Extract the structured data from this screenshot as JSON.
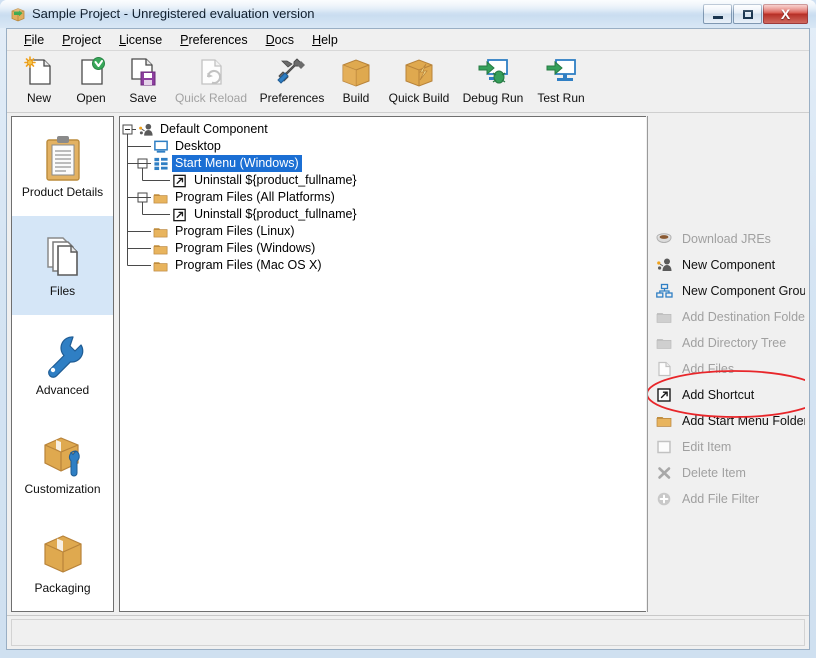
{
  "window": {
    "title": "Sample Project - Unregistered evaluation version",
    "app_icon": "package-box-icon",
    "buttons": {
      "minimize": "minimize-button",
      "maximize": "maximize-button",
      "close_label": "X"
    }
  },
  "menubar": {
    "items": [
      {
        "label": "File",
        "mnemonic": "F"
      },
      {
        "label": "Project",
        "mnemonic": "P"
      },
      {
        "label": "License",
        "mnemonic": "L"
      },
      {
        "label": "Preferences",
        "mnemonic": "P"
      },
      {
        "label": "Docs",
        "mnemonic": "D"
      },
      {
        "label": "Help",
        "mnemonic": "H"
      }
    ]
  },
  "toolbar": {
    "items": [
      {
        "label": "New",
        "icon": "new-document-icon",
        "enabled": true
      },
      {
        "label": "Open",
        "icon": "open-document-icon",
        "enabled": true
      },
      {
        "label": "Save",
        "icon": "save-disk-icon",
        "enabled": true
      },
      {
        "label": "Quick Reload",
        "icon": "quick-reload-icon",
        "enabled": false
      },
      {
        "label": "Preferences",
        "icon": "preferences-tools-icon",
        "enabled": true
      },
      {
        "label": "Build",
        "icon": "build-box-icon",
        "enabled": true
      },
      {
        "label": "Quick Build",
        "icon": "quick-build-box-icon",
        "enabled": true
      },
      {
        "label": "Debug Run",
        "icon": "debug-run-monitor-icon",
        "enabled": true
      },
      {
        "label": "Test Run",
        "icon": "test-run-monitor-icon",
        "enabled": true
      }
    ]
  },
  "sidebar": {
    "items": [
      {
        "label": "Product Details",
        "icon": "clipboard-icon",
        "selected": false
      },
      {
        "label": "Files",
        "icon": "files-stack-icon",
        "selected": true
      },
      {
        "label": "Advanced",
        "icon": "wrench-icon",
        "selected": false
      },
      {
        "label": "Customization",
        "icon": "box-wrench-icon",
        "selected": false
      },
      {
        "label": "Packaging",
        "icon": "box-icon",
        "selected": false
      }
    ]
  },
  "tree": {
    "nodes": [
      {
        "label": "Default Component",
        "icon": "component-icon",
        "depth": 0,
        "expander": "minus",
        "selected": false
      },
      {
        "label": "Desktop",
        "icon": "desktop-monitor-icon",
        "depth": 1,
        "expander": "none",
        "selected": false
      },
      {
        "label": "Start Menu (Windows)",
        "icon": "start-menu-icon",
        "depth": 1,
        "expander": "minus",
        "selected": true
      },
      {
        "label": "Uninstall ${product_fullname}",
        "icon": "shortcut-icon",
        "depth": 2,
        "expander": "none",
        "selected": false
      },
      {
        "label": "Program Files (All Platforms)",
        "icon": "folder-icon",
        "depth": 1,
        "expander": "minus",
        "selected": false
      },
      {
        "label": "Uninstall ${product_fullname}",
        "icon": "shortcut-icon",
        "depth": 2,
        "expander": "none",
        "selected": false
      },
      {
        "label": "Program Files (Linux)",
        "icon": "folder-icon",
        "depth": 1,
        "expander": "none",
        "selected": false
      },
      {
        "label": "Program Files (Windows)",
        "icon": "folder-icon",
        "depth": 1,
        "expander": "none",
        "selected": false
      },
      {
        "label": "Program Files (Mac OS X)",
        "icon": "folder-icon",
        "depth": 1,
        "expander": "none",
        "selected": false
      }
    ]
  },
  "actions": {
    "items": [
      {
        "label": "Download JREs",
        "icon": "coffee-cup-icon",
        "enabled": false,
        "highlighted": false
      },
      {
        "label": "New Component",
        "icon": "component-icon",
        "enabled": true,
        "highlighted": false
      },
      {
        "label": "New Component Group",
        "icon": "component-group-icon",
        "enabled": true,
        "highlighted": false
      },
      {
        "label": "Add Destination Folder",
        "icon": "folder-icon",
        "enabled": false,
        "highlighted": false
      },
      {
        "label": "Add Directory Tree",
        "icon": "folder-icon",
        "enabled": false,
        "highlighted": false
      },
      {
        "label": "Add Files",
        "icon": "file-icon",
        "enabled": false,
        "highlighted": false
      },
      {
        "label": "Add Shortcut",
        "icon": "shortcut-icon",
        "enabled": true,
        "highlighted": true
      },
      {
        "label": "Add Start Menu Folder",
        "icon": "folder-icon",
        "enabled": true,
        "highlighted": false
      },
      {
        "label": "Edit Item",
        "icon": "edit-square-icon",
        "enabled": false,
        "highlighted": false
      },
      {
        "label": "Delete Item",
        "icon": "delete-x-icon",
        "enabled": false,
        "highlighted": false
      },
      {
        "label": "Add File Filter",
        "icon": "plus-circle-icon",
        "enabled": false,
        "highlighted": false
      }
    ]
  },
  "annotation": {
    "shape": "ellipse",
    "color": "#e8262a",
    "target": "Add Shortcut"
  },
  "colors": {
    "selection_blue": "#1b6fd4",
    "sidebar_selection": "#d5e6f7",
    "folder_orange": "#e8b45e",
    "panel_gray": "#f0f0f0",
    "accent_blue": "#2f7fc4"
  },
  "statusbar": {
    "text": ""
  }
}
